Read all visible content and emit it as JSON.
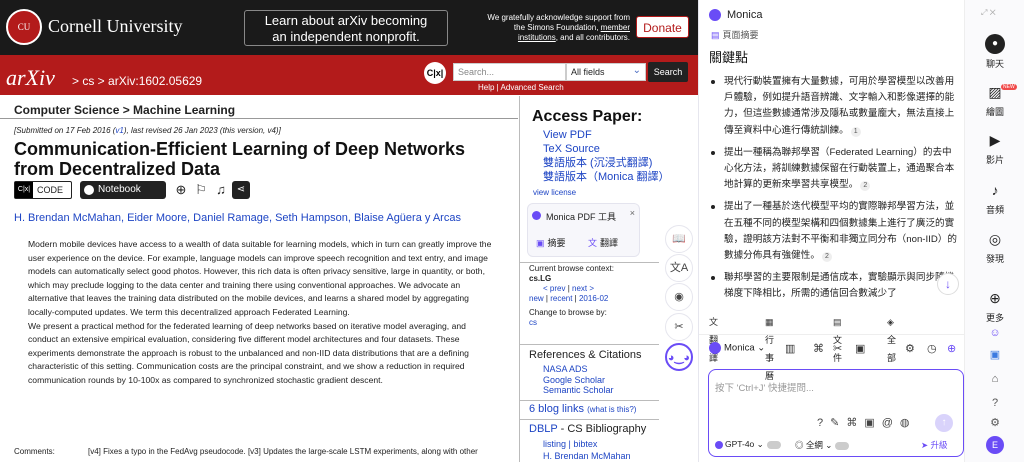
{
  "topbar": {
    "logo_mark": "CU",
    "university": "Cornell University",
    "notice_line1": "Learn about arXiv becoming",
    "notice_line2": "an independent nonprofit.",
    "ack_line1": "We gratefully acknowledge support from",
    "ack_line2": "the Simons Foundation,",
    "ack_member": "member",
    "ack_line3": "institutions",
    "ack_line4": ", and all contributors.",
    "donate_label": "Donate"
  },
  "redbar": {
    "logo": "arXiv",
    "breadcrumb": "> cs > arXiv:1602.05629",
    "cx_label": "C|x|",
    "search_placeholder": "Search...",
    "search_field": "All fields",
    "search_button": "Search",
    "help": "Help | Advanced Search"
  },
  "paper": {
    "subject": "Computer Science > Machine Learning",
    "submitted_prefix": "[Submitted on 17 Feb 2016 (",
    "submitted_v1": "v1",
    "submitted_suffix": "), last revised 26 Jan 2023 (this version, v4)]",
    "title": "Communication-Efficient Learning of Deep Networks from Decentralized Data",
    "code_label": "CODE",
    "notebook_label": "Notebook",
    "authors": "H. Brendan McMahan, Eider Moore, Daniel Ramage, Seth Hampson, Blaise Agüera y Arcas",
    "abstract_p1": "Modern mobile devices have access to a wealth of data suitable for learning models, which in turn can greatly improve the user experience on the device. For example, language models can improve speech recognition and text entry, and image models can automatically select good photos. However, this rich data is often privacy sensitive, large in quantity, or both, which may preclude logging to the data center and training there using conventional approaches. We advocate an alternative that leaves the training data distributed on the mobile devices, and learns a shared model by aggregating locally-computed updates. We term this decentralized approach Federated Learning.",
    "abstract_p2": "We present a practical method for the federated learning of deep networks based on iterative model averaging, and conduct an extensive empirical evaluation, considering five different model architectures and four datasets. These experiments demonstrate the approach is robust to the unbalanced and non-IID data distributions that are a defining characteristic of this setting. Communication costs are the principal constraint, and we show a reduction in required communication rounds by 10-100x as compared to synchronized stochastic gradient descent.",
    "comments_label": "Comments:",
    "comments_text": "[v4] Fixes a typo in the FedAvg pseudocode. [v3] Updates the large-scale LSTM experiments, along with other"
  },
  "sidecol": {
    "access_title": "Access Paper:",
    "links": [
      "View PDF",
      "TeX Source",
      "雙語版本 (沉浸式翻譯)",
      "雙語版本（Monica 翻譯）"
    ],
    "view_license": "view license",
    "monica_tool_title": "Monica PDF 工具",
    "monica_tool_summary": "摘要",
    "monica_tool_translate": "翻譯",
    "browse_context_label": "Current browse context:",
    "browse_context_value": "cs.LG",
    "browse_prev": "< prev",
    "browse_sep": " | ",
    "browse_next": "next >",
    "browse_new": "new",
    "browse_recent": "recent",
    "browse_month": "2016-02",
    "change_browse": "Change to browse by:",
    "change_browse_value": "cs",
    "refs_title": "References & Citations",
    "refs_links": [
      "NASA ADS",
      "Google Scholar",
      "Semantic Scholar"
    ],
    "blog_links": "6 blog links",
    "blog_q": "(what is this?)",
    "dblp_prefix": "DBLP",
    "dblp_title": " - CS Bibliography",
    "dblp_listing": "listing",
    "dblp_bibtex": "bibtex",
    "dblp_author": "H. Brendan McMahan"
  },
  "floating": {
    "book": "📖",
    "translate": "文A",
    "sound": "◉",
    "tools": "✂",
    "monica": "◕‿◕"
  },
  "monica": {
    "title": "Monica",
    "subtitle": "頁面摘要",
    "heading": "關鍵點",
    "points": [
      {
        "text": "現代行動裝置擁有大量數據，可用於學習模型以改善用戶體驗，例如提升語音辨識、文字輸入和影像選擇的能力，但這些數據通常涉及隱私或數量龐大，無法直接上傳至資料中心進行傳統訓練。",
        "cite": "1"
      },
      {
        "text": "提出一種稱為聯邦學習（Federated Learning）的去中心化方法，將訓練數據保留在行動裝置上，通過聚合本地計算的更新來學習共享模型。",
        "cite": "2"
      },
      {
        "text": "提出了一種基於迭代模型平均的實際聯邦學習方法，並在五種不同的模型架構和四個數據集上進行了廣泛的實驗，證明該方法對不平衡和非獨立同分布（non-IID）的數據分佈具有強健性。",
        "cite": "2"
      },
      {
        "text": "聯邦學習的主要限制是通信成本，實驗顯示與同步隨機梯度下降相比，所需的通信回合數減少了",
        "cite": ""
      }
    ],
    "actions": [
      "翻譯",
      "行事曆",
      "文件",
      "全部"
    ],
    "model_label": "Monica",
    "input_placeholder": "按下 'Ctrl+J' 快捷提問...",
    "gpt_label": "GPT-4o",
    "web_label": "全網",
    "upgrade_label": "升級"
  },
  "rightbar": {
    "items": [
      "聊天",
      "繪圖",
      "影片",
      "音頻",
      "發現",
      "更多"
    ],
    "new_badge": "NEW",
    "avatar": "E"
  }
}
